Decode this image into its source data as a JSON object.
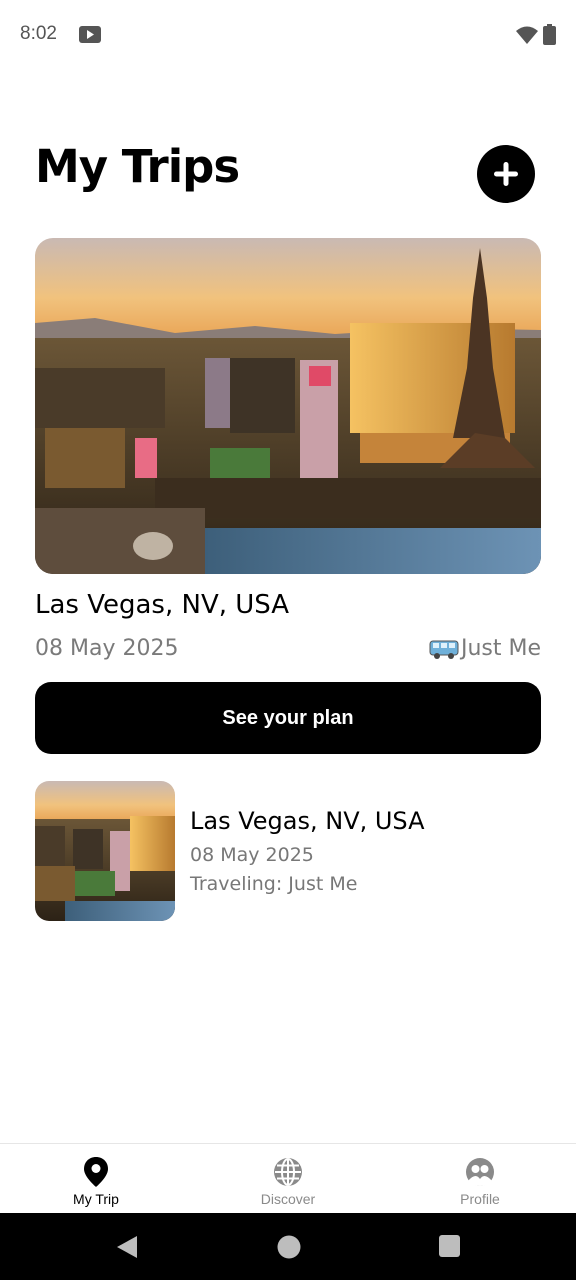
{
  "status_bar": {
    "time": "8:02"
  },
  "header": {
    "title": "My Trips",
    "add_icon": "plus-icon"
  },
  "featured_trip": {
    "destination": "Las Vegas, NV, USA",
    "date": "08 May 2025",
    "traveler_icon": "bus-icon",
    "traveler": "Just Me",
    "button_label": "See your plan"
  },
  "trips": [
    {
      "destination": "Las Vegas, NV, USA",
      "date": "08 May 2025",
      "traveler": "Traveling: Just Me"
    }
  ],
  "bottom_nav": {
    "items": [
      {
        "label": "My Trip",
        "icon": "location-pin-icon",
        "active": true
      },
      {
        "label": "Discover",
        "icon": "globe-icon",
        "active": false
      },
      {
        "label": "Profile",
        "icon": "people-icon",
        "active": false
      }
    ]
  },
  "colors": {
    "primary": "#000000",
    "muted_text": "#7a7a7a",
    "inactive_nav": "#8a8a8a"
  }
}
